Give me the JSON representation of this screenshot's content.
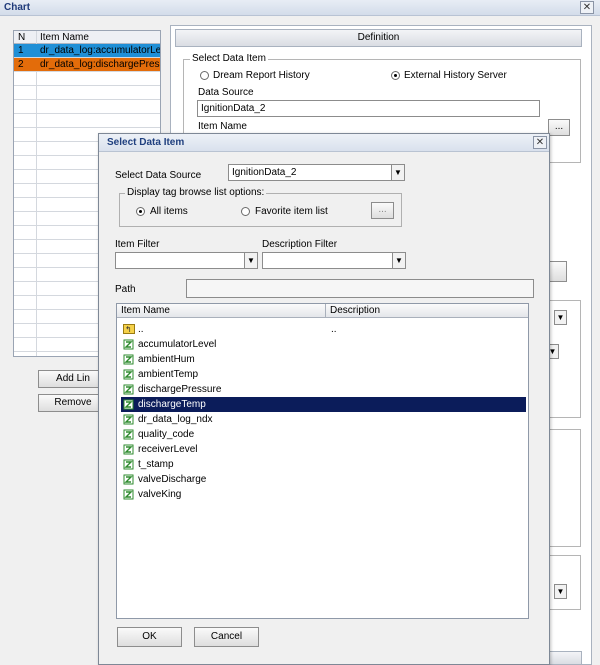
{
  "window": {
    "title": "Chart",
    "close_glyph": "✕"
  },
  "grid": {
    "col_n": "N",
    "col_item": "Item Name",
    "rows": [
      {
        "n": "1",
        "item": "dr_data_log:accumulatorLe",
        "color": "#1f8fd6"
      },
      {
        "n": "2",
        "item": "dr_data_log:dischargePress",
        "color": "#e36c0a"
      }
    ]
  },
  "left_buttons": {
    "add": "Add Lin",
    "remove": "Remove"
  },
  "definition": {
    "header": "Definition",
    "select_data_item_legend": "Select Data Item",
    "radio_dream": "Dream Report History",
    "radio_external": "External History Server",
    "data_source_label": "Data Source",
    "data_source_value": "IgnitionData_2",
    "item_name_label": "Item Name",
    "browse": "..."
  },
  "dialog": {
    "title": "Select Data Item",
    "close_glyph": "✕",
    "select_source_label": "Select Data Source",
    "source_value": "IgnitionData_2",
    "display_legend": "Display tag browse list options:",
    "opt_all": "All items",
    "opt_fav": "Favorite item list",
    "fav_browse": "...",
    "item_filter_label": "Item Filter",
    "desc_filter_label": "Description Filter",
    "path_label": "Path",
    "path_value": "",
    "col_item_name": "Item Name",
    "col_description": "Description",
    "parent_name": "..",
    "parent_desc": "..",
    "items": [
      "accumulatorLevel",
      "ambientHum",
      "ambientTemp",
      "dischargePressure",
      "dischargeTemp",
      "dr_data_log_ndx",
      "quality_code",
      "receiverLevel",
      "t_stamp",
      "valveDischarge",
      "valveKing"
    ],
    "selected_index": 4,
    "ok": "OK",
    "cancel": "Cancel"
  },
  "colors": {
    "selection": "#0b1c5a",
    "tag_icon": "#2e8b2e"
  }
}
